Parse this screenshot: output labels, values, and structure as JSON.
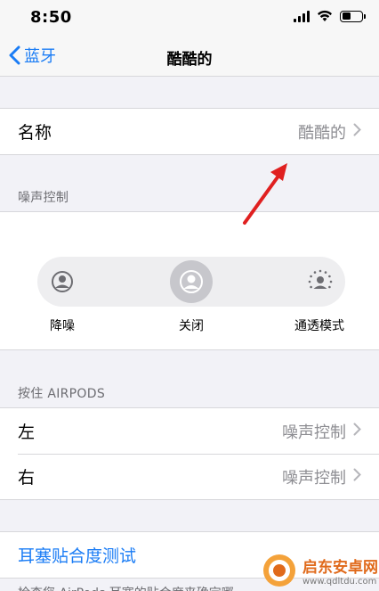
{
  "status_bar": {
    "time": "8:50"
  },
  "nav": {
    "back_label": "蓝牙",
    "title": "酷酷的"
  },
  "name_row": {
    "label": "名称",
    "value": "酷酷的"
  },
  "noise_control": {
    "header": "噪声控制",
    "options": [
      {
        "label": "降噪",
        "icon": "noise-cancel-icon",
        "selected": false
      },
      {
        "label": "关闭",
        "icon": "person-icon",
        "selected": true
      },
      {
        "label": "通透模式",
        "icon": "transparency-icon",
        "selected": false
      }
    ]
  },
  "airpods_press": {
    "header": "按住 AIRPODS",
    "rows": [
      {
        "label": "左",
        "value": "噪声控制"
      },
      {
        "label": "右",
        "value": "噪声控制"
      }
    ]
  },
  "ear_tip_test": {
    "label": "耳塞贴合度测试"
  },
  "footer": {
    "text": "检查您 AirPods 耳塞的贴合度来确定哪"
  },
  "watermark": {
    "title": "启东安卓网",
    "url": "www.qdltdu.com"
  },
  "colors": {
    "accent": "#1a7cf5",
    "annotation_arrow": "#e02020"
  }
}
